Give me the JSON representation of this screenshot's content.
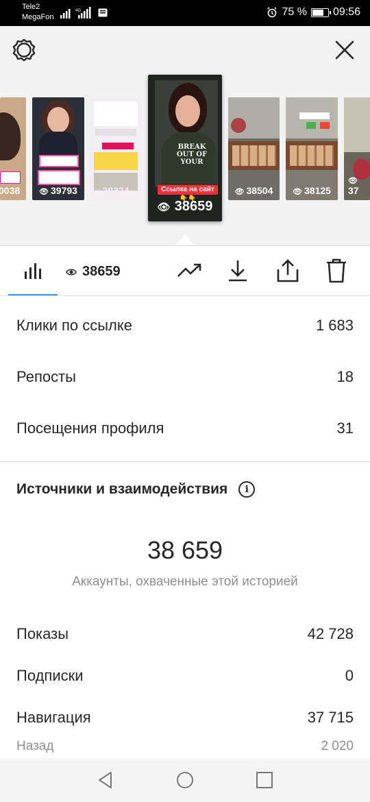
{
  "status_bar": {
    "carrier1": "Tele2",
    "carrier2": "MegaFon",
    "battery": "75 %",
    "time": "09:56",
    "battery_level": 0.75
  },
  "stories": {
    "items": [
      {
        "count": "0038",
        "bg": "#c9a98a"
      },
      {
        "count": "39793",
        "bg": "#2b2f38"
      },
      {
        "count": "39324",
        "bg": "#f3eef3"
      },
      {
        "count": "38659",
        "bg": "#1f2421"
      },
      {
        "count": "38504",
        "bg": "#6f6b66"
      },
      {
        "count": "38125",
        "bg": "#807a70"
      },
      {
        "count": "37",
        "bg": "#6b6458"
      }
    ],
    "main_label": "Ссылка на сайт 👇👇",
    "tshirt_text": "BREAK OUT OF YOUR"
  },
  "toolbar": {
    "views": "38659"
  },
  "stats": [
    {
      "label": "Клики по ссылке",
      "value": "1 683"
    },
    {
      "label": "Репосты",
      "value": "18"
    },
    {
      "label": "Посещения профиля",
      "value": "31"
    }
  ],
  "section": {
    "title": "Источники и взаимодействия",
    "info_icon_glyph": "i",
    "reach": "38 659",
    "reach_caption": "Аккаунты, охваченные этой историей"
  },
  "details": [
    {
      "label": "Показы",
      "value": "42 728"
    },
    {
      "label": "Подписки",
      "value": "0"
    },
    {
      "label": "Навигация",
      "value": "37 715"
    }
  ],
  "subdetails": [
    {
      "label": "Назад",
      "value": "2 020"
    }
  ],
  "colors": {
    "accent": "#3897f0",
    "text": "#262626",
    "muted": "#8e8e8e"
  }
}
